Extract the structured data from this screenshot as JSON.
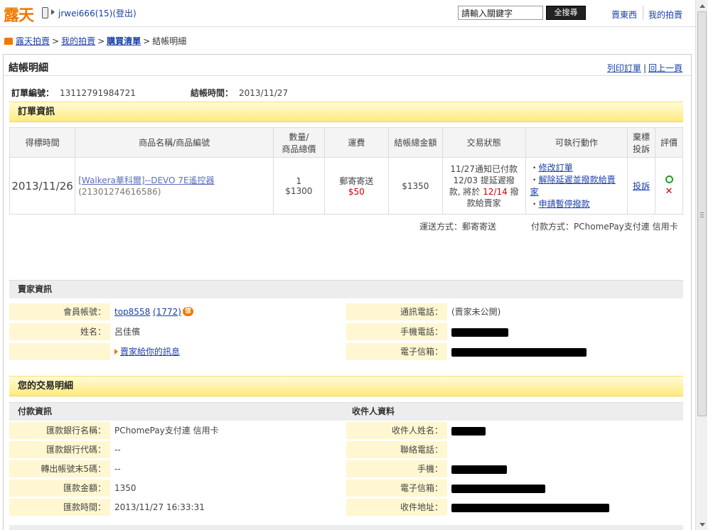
{
  "header": {
    "logo_text": "露天",
    "user_text": "jrwei666(15)",
    "logout_label": "(登出)",
    "search_placeholder": "請輸入關鍵字",
    "search_button": "全搜尋",
    "link_sell": "賣東西",
    "link_my": "我的拍賣"
  },
  "breadcrumb": {
    "items": [
      "露天拍賣",
      "我的拍賣",
      "購買清單"
    ],
    "current": "結帳明細"
  },
  "page": {
    "title": "結帳明細",
    "print_label": "列印訂單",
    "back_label": "回上一頁",
    "order_no_label": "訂單編號：",
    "order_no": "13112791984721",
    "checkout_time_label": "結帳時間：",
    "checkout_time": "2013/11/27"
  },
  "order_section": {
    "title": "訂單資訊",
    "headers": [
      "得標時間",
      "商品名稱/商品編號",
      "數量/",
      "商品總價",
      "運費",
      "結帳總金額",
      "交易狀態",
      "可執行動作",
      "棄標",
      "投訴",
      "評價"
    ],
    "row": {
      "date": "2013/11/26",
      "item_name": "[Walkera華科爾]--DEVO 7E遙控器",
      "item_code": "(21301274616586)",
      "qty": "1",
      "total": "$1300",
      "ship_method": "郵寄寄送",
      "ship_fee": "$50",
      "checkout_total": "$1350",
      "status_1": "11/27通知已付款",
      "status_2": "12/03 提延遲撥",
      "status_3": "款, 將於",
      "status_date": "12/14",
      "status_4": "撥",
      "status_5": "款給賣家",
      "action_1": "修改訂單",
      "action_2": "解除延遲並撥款給賣家",
      "action_3": "申請暫停撥款",
      "complain": "投訴"
    },
    "ship_label": "運送方式：郵寄寄送",
    "pay_label": "付款方式：PChomePay支付連 信用卡"
  },
  "seller": {
    "title": "賣家資訊",
    "account_label": "會員帳號：",
    "account": "top8558",
    "account_score": "(1772)",
    "credit_badge": "信",
    "name_label": "姓名：",
    "name": "呂佳儐",
    "message_link": "賣家給你的訊息",
    "phone_label": "通訊電話：",
    "phone": "(賣家未公開)",
    "mobile_label": "手機電話：",
    "email_label": "電子信箱："
  },
  "transaction": {
    "title": "您的交易明細",
    "pay_title": "付款資訊",
    "receiver_title": "收件人資料",
    "bank_name_label": "匯款銀行名稱：",
    "bank_name": "PChomePay支付連 信用卡",
    "bank_code_label": "匯款銀行代碼：",
    "bank_code": "--",
    "account_last5_label": "轉出帳號末5碼：",
    "account_last5": "--",
    "amount_label": "匯款金額：",
    "amount": "1350",
    "remit_time_label": "匯款時間：",
    "remit_time": "2013/11/27 16:33:31",
    "recv_name_label": "收件人姓名：",
    "recv_phone_label": "聯絡電話：",
    "recv_mobile_label": "手機：",
    "recv_email_label": "電子信箱：",
    "recv_addr_label": "收件地址："
  }
}
